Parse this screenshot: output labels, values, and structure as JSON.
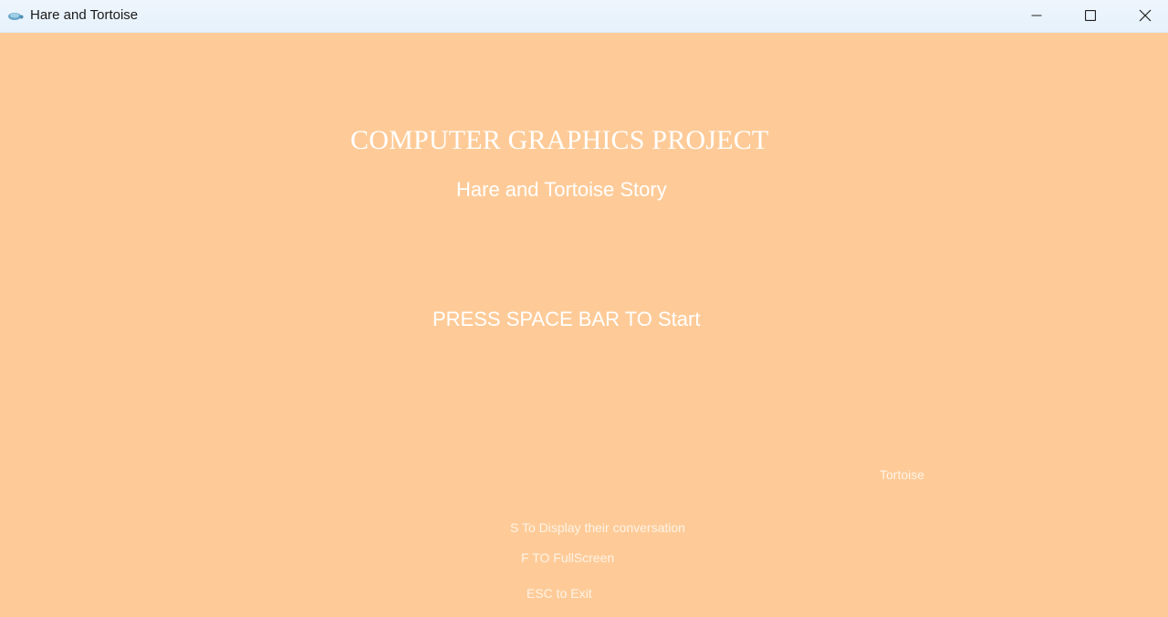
{
  "window": {
    "title": "Hare and Tortoise",
    "app_icon": "tortoise-app-icon",
    "controls": {
      "minimize_icon": "minimize-icon",
      "maximize_icon": "maximize-icon",
      "close_icon": "close-icon"
    }
  },
  "scene": {
    "background_color": "#fecb98",
    "text_color": "#ffffff",
    "title": "COMPUTER GRAPHICS PROJECT",
    "subtitle": "Hare and Tortoise Story",
    "start_prompt": "PRESS SPACE BAR TO Start",
    "character_label": "Tortoise",
    "hints": {
      "conversation": "S To Display their conversation",
      "fullscreen": "F TO FullScreen",
      "exit": "ESC to Exit"
    }
  }
}
